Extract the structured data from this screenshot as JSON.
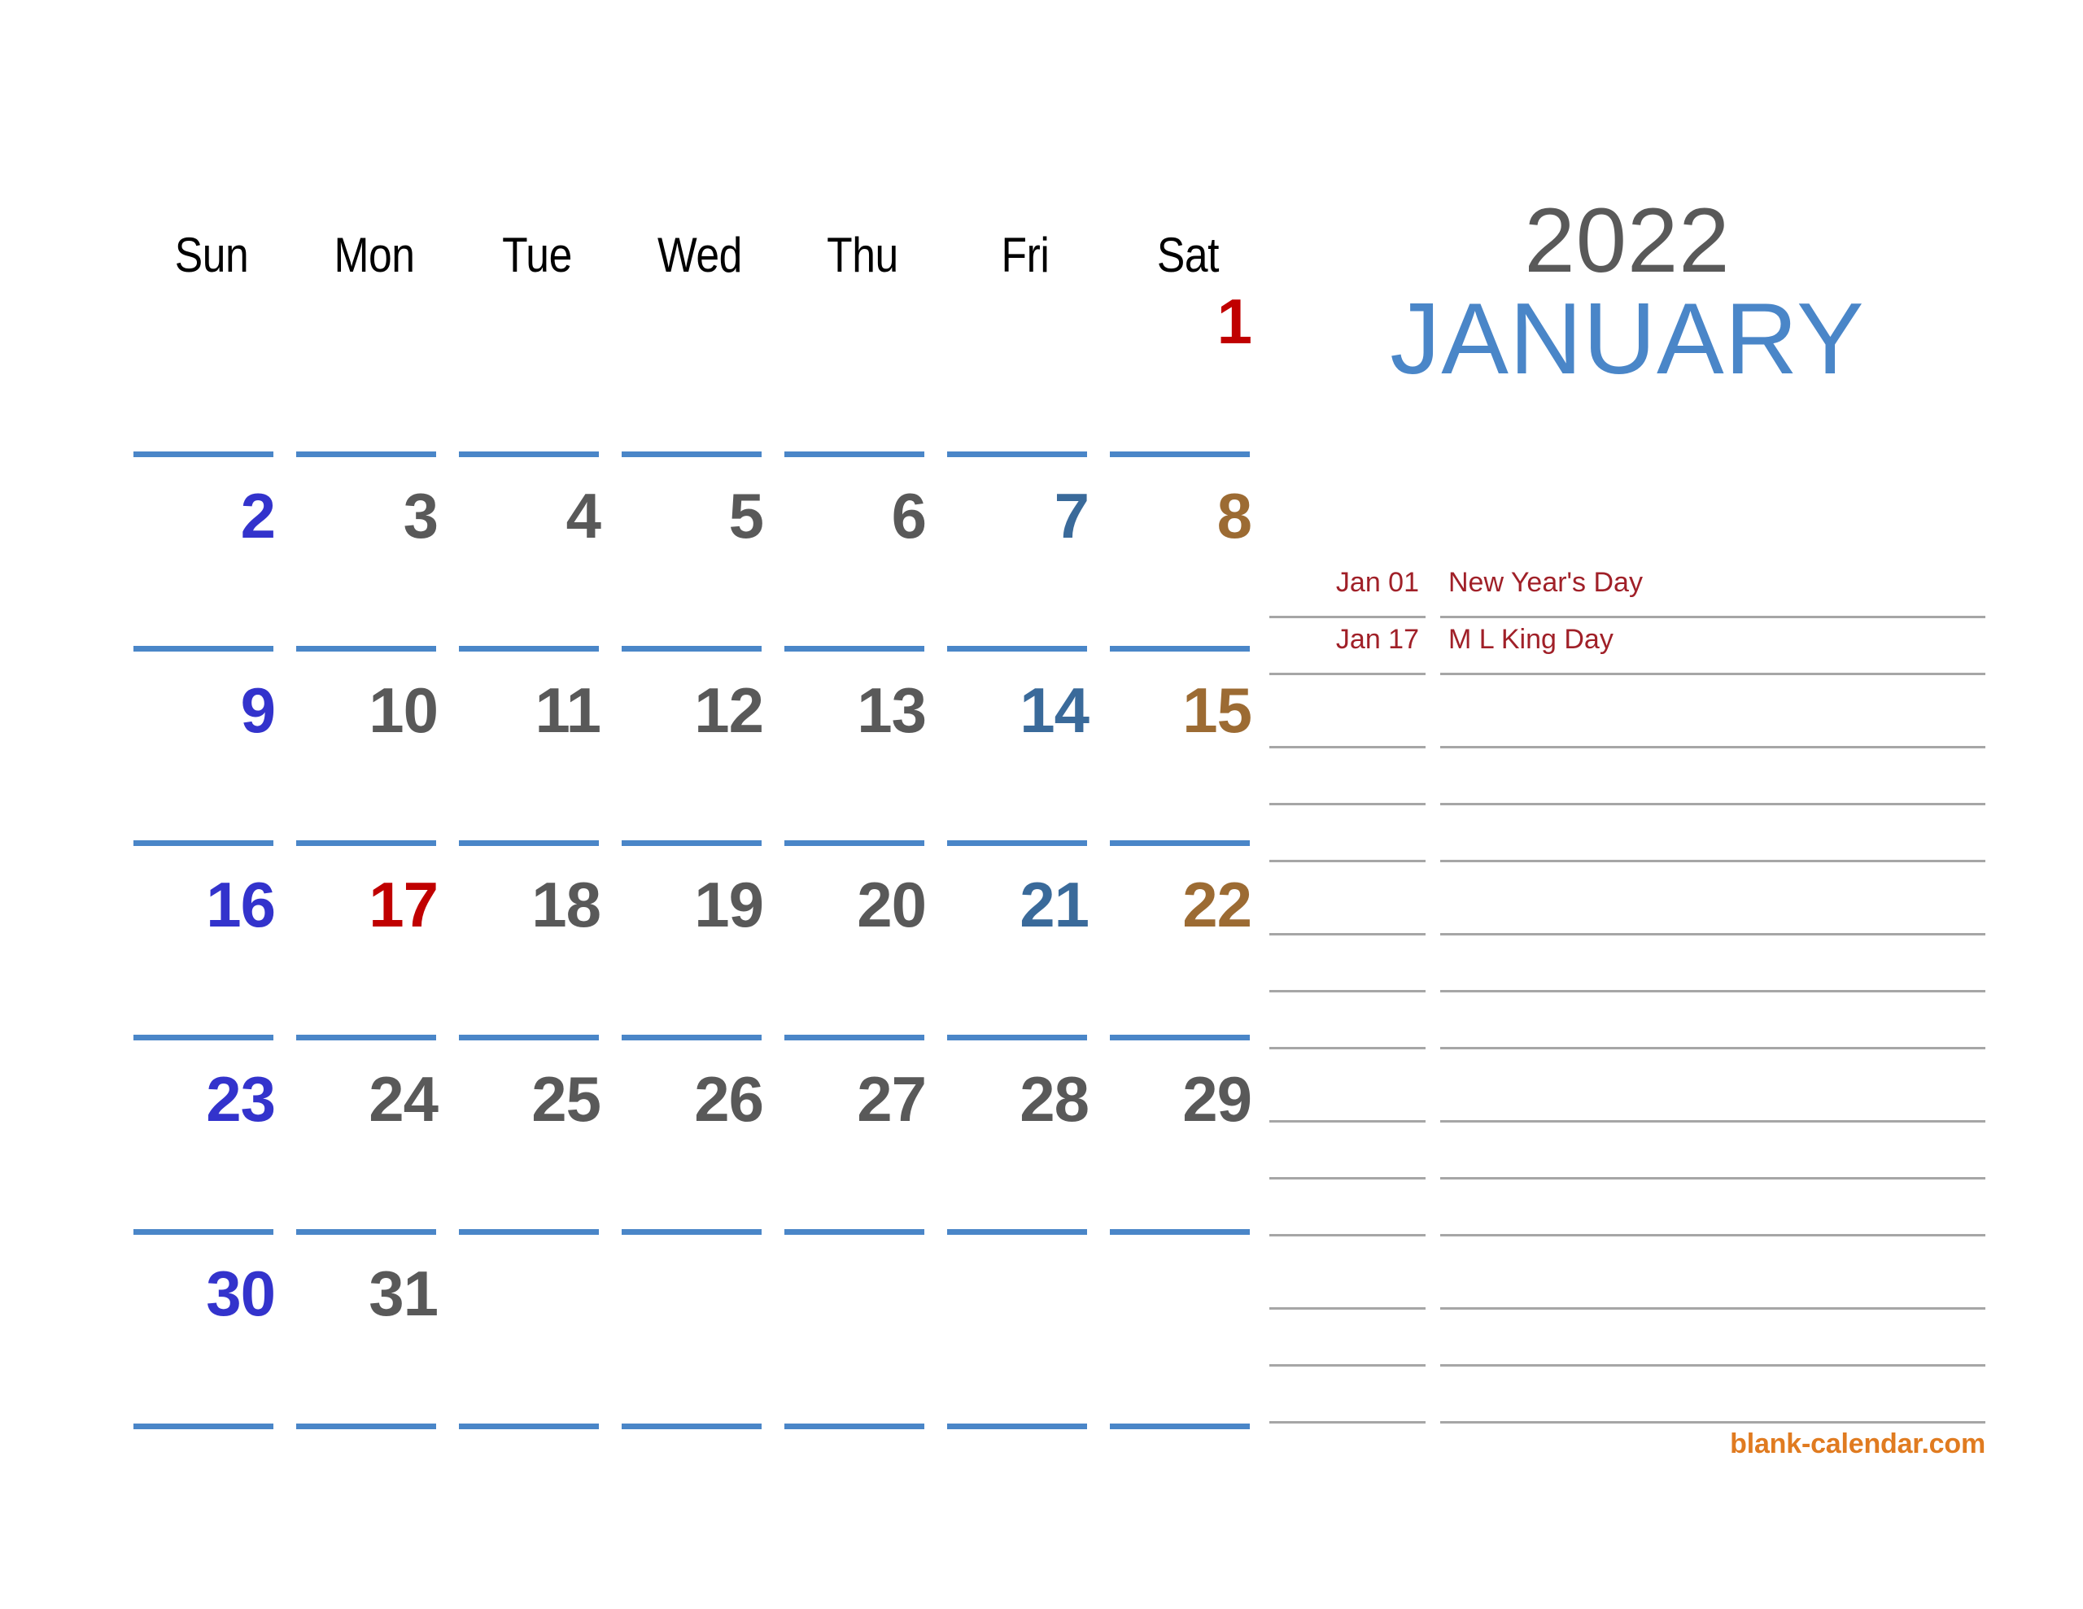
{
  "title": {
    "year": "2022",
    "month": "JANUARY",
    "year_color": "#595959",
    "month_color": "#4a86c8"
  },
  "weekday_headers": [
    "Sun",
    "Mon",
    "Tue",
    "Wed",
    "Thu",
    "Fri",
    "Sat"
  ],
  "colors": {
    "sunday": "#3333cc",
    "weekday": "#595959",
    "friday": "#3a6a9a",
    "saturday": "#9c6b33",
    "holiday": "#c00000",
    "underline": "#4a86c8",
    "note_line": "#a6a6a6",
    "holiday_text": "#a02028",
    "watermark": "#e07b20",
    "header": "#000000"
  },
  "weeks": [
    [
      {
        "day": "",
        "color": ""
      },
      {
        "day": "",
        "color": ""
      },
      {
        "day": "",
        "color": ""
      },
      {
        "day": "",
        "color": ""
      },
      {
        "day": "",
        "color": ""
      },
      {
        "day": "",
        "color": ""
      },
      {
        "day": "1",
        "color": "#c00000"
      }
    ],
    [
      {
        "day": "2",
        "color": "#3333cc"
      },
      {
        "day": "3",
        "color": "#595959"
      },
      {
        "day": "4",
        "color": "#595959"
      },
      {
        "day": "5",
        "color": "#595959"
      },
      {
        "day": "6",
        "color": "#595959"
      },
      {
        "day": "7",
        "color": "#3a6a9a"
      },
      {
        "day": "8",
        "color": "#9c6b33"
      }
    ],
    [
      {
        "day": "9",
        "color": "#3333cc"
      },
      {
        "day": "10",
        "color": "#595959"
      },
      {
        "day": "11",
        "color": "#595959"
      },
      {
        "day": "12",
        "color": "#595959"
      },
      {
        "day": "13",
        "color": "#595959"
      },
      {
        "day": "14",
        "color": "#3a6a9a"
      },
      {
        "day": "15",
        "color": "#9c6b33"
      }
    ],
    [
      {
        "day": "16",
        "color": "#3333cc"
      },
      {
        "day": "17",
        "color": "#c00000"
      },
      {
        "day": "18",
        "color": "#595959"
      },
      {
        "day": "19",
        "color": "#595959"
      },
      {
        "day": "20",
        "color": "#595959"
      },
      {
        "day": "21",
        "color": "#3a6a9a"
      },
      {
        "day": "22",
        "color": "#9c6b33"
      }
    ],
    [
      {
        "day": "23",
        "color": "#3333cc"
      },
      {
        "day": "24",
        "color": "#595959"
      },
      {
        "day": "25",
        "color": "#595959"
      },
      {
        "day": "26",
        "color": "#595959"
      },
      {
        "day": "27",
        "color": "#595959"
      },
      {
        "day": "28",
        "color": "#595959"
      },
      {
        "day": "29",
        "color": "#595959"
      }
    ],
    [
      {
        "day": "30",
        "color": "#3333cc"
      },
      {
        "day": "31",
        "color": "#595959"
      },
      {
        "day": "",
        "color": ""
      },
      {
        "day": "",
        "color": ""
      },
      {
        "day": "",
        "color": ""
      },
      {
        "day": "",
        "color": ""
      },
      {
        "day": "",
        "color": ""
      }
    ]
  ],
  "notes": [
    {
      "date": "Jan 01",
      "text": "New Year's Day",
      "tall": false
    },
    {
      "date": "Jan 17",
      "text": "M L King Day",
      "tall": false
    },
    {
      "date": "",
      "text": "",
      "tall": true
    },
    {
      "date": "",
      "text": "",
      "tall": false
    },
    {
      "date": "",
      "text": "",
      "tall": false
    },
    {
      "date": "",
      "text": "",
      "tall": true
    },
    {
      "date": "",
      "text": "",
      "tall": false
    },
    {
      "date": "",
      "text": "",
      "tall": false
    },
    {
      "date": "",
      "text": "",
      "tall": true
    },
    {
      "date": "",
      "text": "",
      "tall": false
    },
    {
      "date": "",
      "text": "",
      "tall": false
    },
    {
      "date": "",
      "text": "",
      "tall": true
    },
    {
      "date": "",
      "text": "",
      "tall": false
    },
    {
      "date": "",
      "text": "",
      "tall": false
    }
  ],
  "footer": {
    "watermark": "blank-calendar.com"
  }
}
